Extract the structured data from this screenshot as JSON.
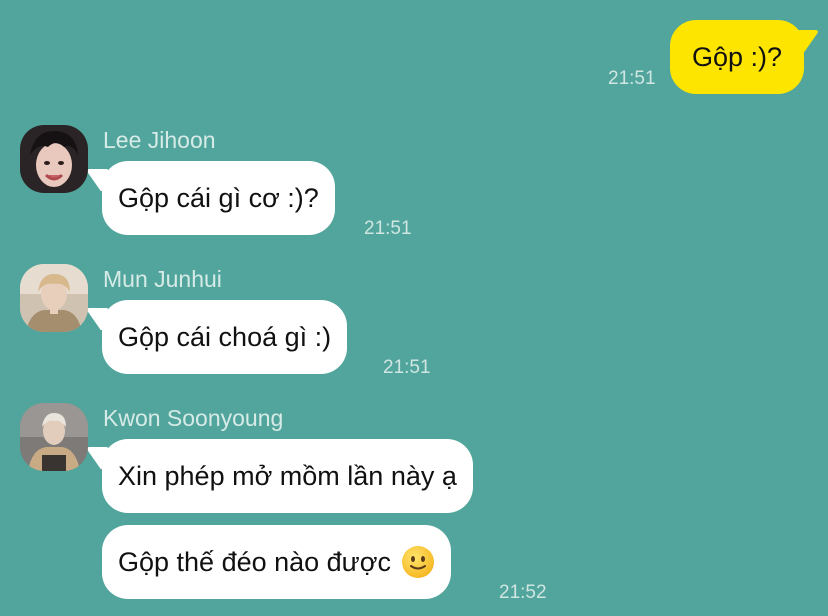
{
  "messages": {
    "outgoing": {
      "text": "Gộp :)?",
      "time": "21:51"
    },
    "lee": {
      "sender": "Lee Jihoon",
      "text": "Gộp cái gì cơ :)?",
      "time": "21:51"
    },
    "mun": {
      "sender": "Mun Junhui",
      "text": "Gộp cái choá gì :)",
      "time": "21:51"
    },
    "kwon": {
      "sender": "Kwon Soonyoung",
      "text1": "Xin phép mở mồm lần này ạ",
      "text2": "Gộp thế đéo nào được",
      "emoji": "slightly-smiling-face-icon",
      "time": "21:52"
    }
  },
  "colors": {
    "background": "#52a59c",
    "outgoing_bubble": "#fde500",
    "incoming_bubble": "#ffffff"
  }
}
